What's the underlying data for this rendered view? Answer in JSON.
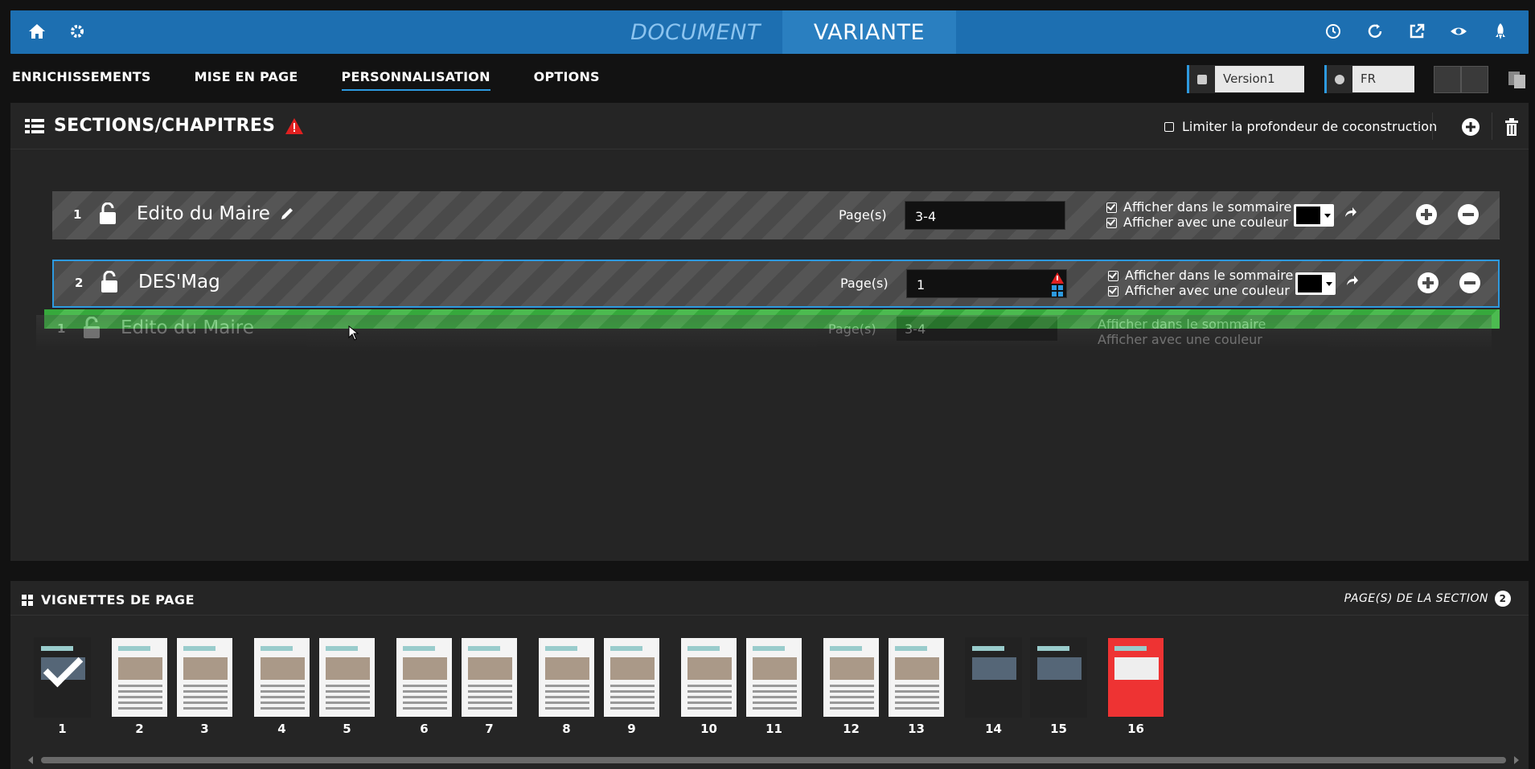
{
  "topbar": {
    "mode_document": "DOCUMENT",
    "mode_variante": "VARIANTE",
    "left_icons": [
      "home-icon",
      "gear-icon"
    ],
    "right_icons": [
      "history-icon",
      "refresh-icon",
      "external-link-icon",
      "eye-icon",
      "rocket-icon"
    ]
  },
  "nav": {
    "tabs": [
      "ENRICHISSEMENTS",
      "MISE EN PAGE",
      "PERSONNALISATION",
      "OPTIONS"
    ],
    "active": "PERSONNALISATION"
  },
  "version": {
    "value": "Version1"
  },
  "language": {
    "value": "FR"
  },
  "sections": {
    "title": "SECTIONS/CHAPITRES",
    "limit_label": "Limiter la profondeur de coconstruction",
    "rows": [
      {
        "num": "1",
        "name": "Edito du Maire",
        "pages_label": "Page(s)",
        "pages": "3-4",
        "check1": "Afficher dans le sommaire",
        "check2": "Afficher avec une couleur"
      },
      {
        "num": "2",
        "name": "DES'Mag",
        "pages_label": "Page(s)",
        "pages": "1",
        "check1": "Afficher dans le sommaire",
        "check2": "Afficher avec une couleur"
      }
    ],
    "ghost": {
      "num": "1",
      "name": "Edito du Maire",
      "pages_label": "Page(s)",
      "pages": "3-4",
      "check1": "Afficher dans le sommaire",
      "check2": "Afficher avec une couleur"
    }
  },
  "thumbnails": {
    "title": "VIGNETTES DE PAGE",
    "right_label": "PAGE(S) DE LA SECTION",
    "badge": "2",
    "pages": [
      "1",
      "2",
      "3",
      "4",
      "5",
      "6",
      "7",
      "8",
      "9",
      "10",
      "11",
      "12",
      "13",
      "14",
      "15",
      "16"
    ]
  }
}
